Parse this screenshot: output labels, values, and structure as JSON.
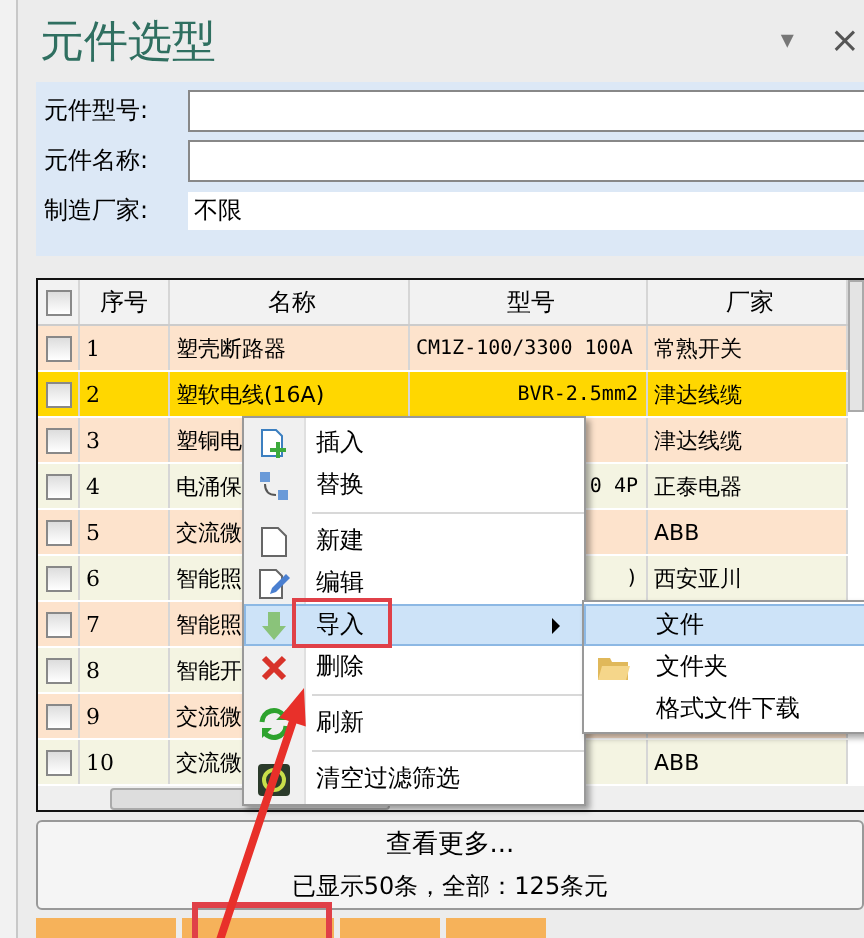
{
  "panel": {
    "title": "元件选型",
    "pin_glyph": "▾",
    "close_glyph": "×"
  },
  "filters": [
    {
      "label": "元件型号:",
      "kind": "text"
    },
    {
      "label": "元件名称:",
      "kind": "text"
    },
    {
      "label": "制造厂家:",
      "kind": "select",
      "value": "不限"
    }
  ],
  "table": {
    "columns": [
      "序号",
      "名称",
      "型号",
      "厂家"
    ],
    "header_checked": false,
    "rows": [
      {
        "cells": [
          "1",
          "塑壳断路器",
          "CM1Z-100/3300 100A",
          "常熟开关"
        ],
        "checked": false,
        "selected": false
      },
      {
        "cells": [
          "2",
          "塑软电线(16A)",
          "BVR-2.5mm2",
          "津达线缆"
        ],
        "checked": false,
        "selected": true
      },
      {
        "cells": [
          "3",
          "塑铜电",
          "",
          "津达线缆"
        ],
        "checked": false,
        "selected": false
      },
      {
        "cells": [
          "4",
          "电涌保",
          "0 4P",
          "正泰电器"
        ],
        "checked": false,
        "selected": false
      },
      {
        "cells": [
          "5",
          "交流微",
          "",
          "ABB"
        ],
        "checked": false,
        "selected": false
      },
      {
        "cells": [
          "6",
          "智能照",
          ")",
          "西安亚川"
        ],
        "checked": false,
        "selected": false
      },
      {
        "cells": [
          "7",
          "智能照",
          "",
          ""
        ],
        "checked": false,
        "selected": false
      },
      {
        "cells": [
          "8",
          "智能开",
          "",
          ""
        ],
        "checked": false,
        "selected": false
      },
      {
        "cells": [
          "9",
          "交流微",
          "",
          ""
        ],
        "checked": false,
        "selected": false
      },
      {
        "cells": [
          "10",
          "交流微",
          "",
          "ABB"
        ],
        "checked": false,
        "selected": false
      }
    ]
  },
  "context_menu": {
    "items": [
      {
        "kind": "item",
        "label": "插入",
        "selected": false
      },
      {
        "kind": "item",
        "label": "替换",
        "selected": false
      },
      {
        "kind": "separator"
      },
      {
        "kind": "item",
        "label": "新建",
        "selected": false
      },
      {
        "kind": "item",
        "label": "编辑",
        "selected": false
      },
      {
        "kind": "submenu",
        "label": "导入",
        "selected": true
      },
      {
        "kind": "item",
        "label": "删除",
        "selected": false
      },
      {
        "kind": "separator"
      },
      {
        "kind": "item",
        "label": "刷新",
        "selected": false
      },
      {
        "kind": "separator"
      },
      {
        "kind": "item",
        "label": "清空过滤筛选",
        "selected": false
      }
    ],
    "submenu": [
      {
        "label": "文件",
        "selected": true
      },
      {
        "label": "文件夹",
        "selected": false
      },
      {
        "label": "格式文件下载",
        "selected": false
      }
    ]
  },
  "footer": {
    "more": "查看更多...",
    "summary": "已显示50条，全部：125条元"
  }
}
